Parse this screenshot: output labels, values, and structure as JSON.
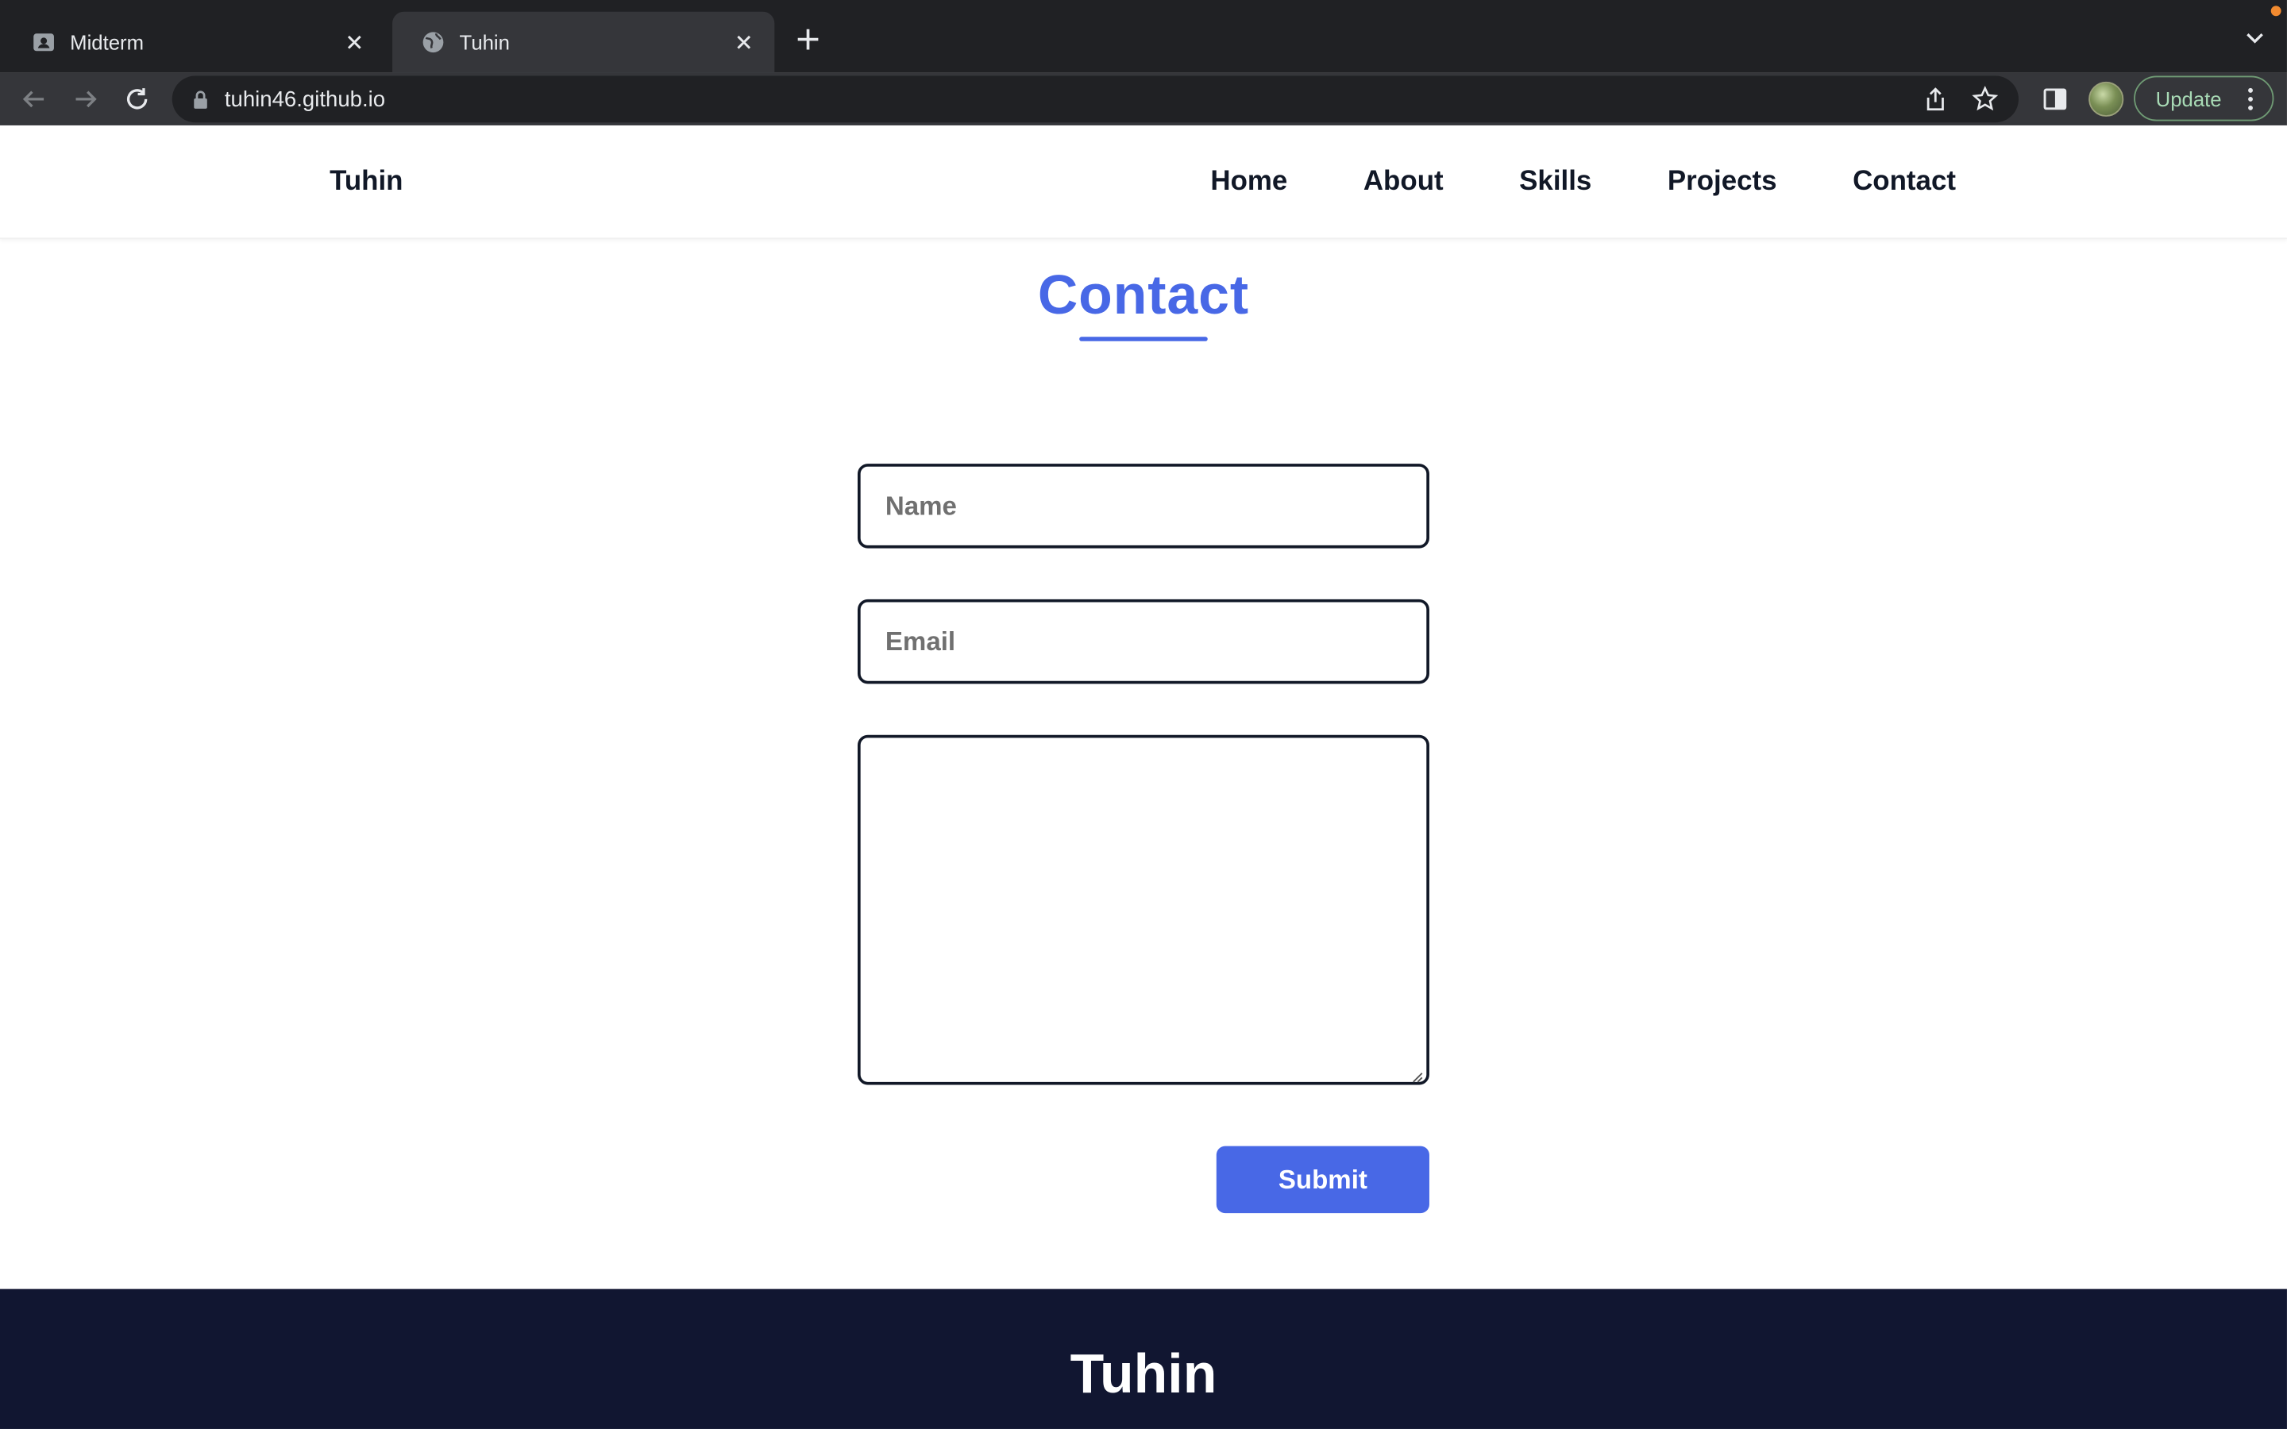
{
  "browser": {
    "tabs": [
      {
        "title": "Midterm",
        "active": false,
        "favicon": "contact-card-icon"
      },
      {
        "title": "Tuhin",
        "active": true,
        "favicon": "globe-icon"
      }
    ],
    "url": "tuhin46.github.io",
    "update_label": "Update"
  },
  "site": {
    "brand": "Tuhin",
    "nav": [
      {
        "label": "Home"
      },
      {
        "label": "About"
      },
      {
        "label": "Skills"
      },
      {
        "label": "Projects"
      },
      {
        "label": "Contact"
      }
    ],
    "accent_color": "#4868e6",
    "footer_color": "#111631"
  },
  "contact": {
    "title": "Contact",
    "name_placeholder": "Name",
    "email_placeholder": "Email",
    "message_value": "",
    "submit_label": "Submit"
  },
  "footer": {
    "brand": "Tuhin"
  }
}
